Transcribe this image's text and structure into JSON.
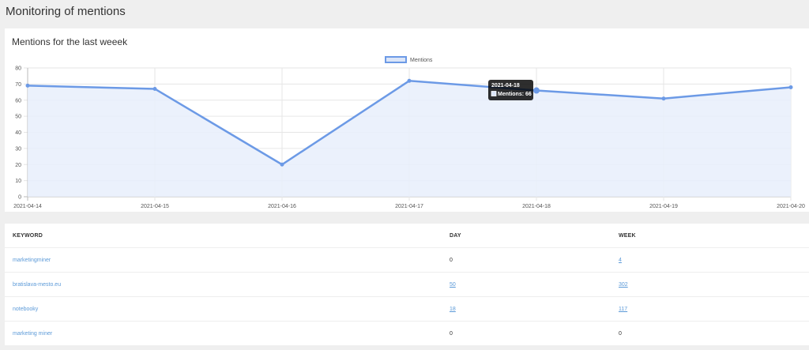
{
  "page": {
    "title": "Monitoring of mentions"
  },
  "chart_card": {
    "title": "Mentions for the last weeek"
  },
  "chart_data": {
    "type": "line",
    "x": [
      "2021-04-14",
      "2021-04-15",
      "2021-04-16",
      "2021-04-17",
      "2021-04-18",
      "2021-04-19",
      "2021-04-20"
    ],
    "series": [
      {
        "name": "Mentions",
        "values": [
          69,
          67,
          20,
          72,
          66,
          61,
          68
        ]
      }
    ],
    "ylim": [
      0,
      80
    ],
    "yticks": [
      0,
      10,
      20,
      30,
      40,
      50,
      60,
      70,
      80
    ],
    "grid": true,
    "legend": "top-center",
    "colors": {
      "line": "#6c9ae6",
      "fill": "#e8eefb"
    },
    "tooltip": {
      "title": "2021-04-18",
      "label": "Mentions: 66"
    }
  },
  "table": {
    "headers": {
      "keyword": "KEYWORD",
      "day": "DAY",
      "week": "WEEK"
    },
    "rows": [
      {
        "keyword": "marketingminer",
        "day": "0",
        "week": "4"
      },
      {
        "keyword": "bratislava-mesto.eu",
        "day": "50",
        "week": "302"
      },
      {
        "keyword": "notebooky",
        "day": "18",
        "week": "117"
      },
      {
        "keyword": "marketing miner",
        "day": "0",
        "week": "0"
      }
    ]
  }
}
